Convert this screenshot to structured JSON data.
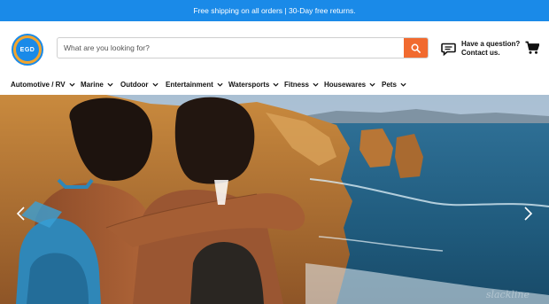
{
  "promo": {
    "text": "Free shipping on all orders | 30-Day free returns."
  },
  "logo": {
    "text": "EGD"
  },
  "search": {
    "placeholder": "What are you looking for?"
  },
  "help": {
    "line1": "Have a question?",
    "line2": "Contact us."
  },
  "nav": {
    "items": [
      {
        "label": "Automotive / RV"
      },
      {
        "label": "Marine"
      },
      {
        "label": "Outdoor"
      },
      {
        "label": "Entertainment"
      },
      {
        "label": "Watersports"
      },
      {
        "label": "Fitness"
      },
      {
        "label": "Housewares"
      },
      {
        "label": "Pets"
      }
    ]
  },
  "hero": {
    "watermark": "slackline"
  },
  "colors": {
    "promo_bar": "#1a8ae8",
    "search_button": "#f16a2f",
    "logo_ring": "#1a8ae8",
    "logo_fill": "#f3a52d"
  },
  "icons": {
    "search": "search-icon",
    "chat": "chat-bubble-icon",
    "cart": "cart-icon",
    "caret": "chevron-down-icon",
    "prev": "chevron-left-icon",
    "next": "chevron-right-icon"
  }
}
